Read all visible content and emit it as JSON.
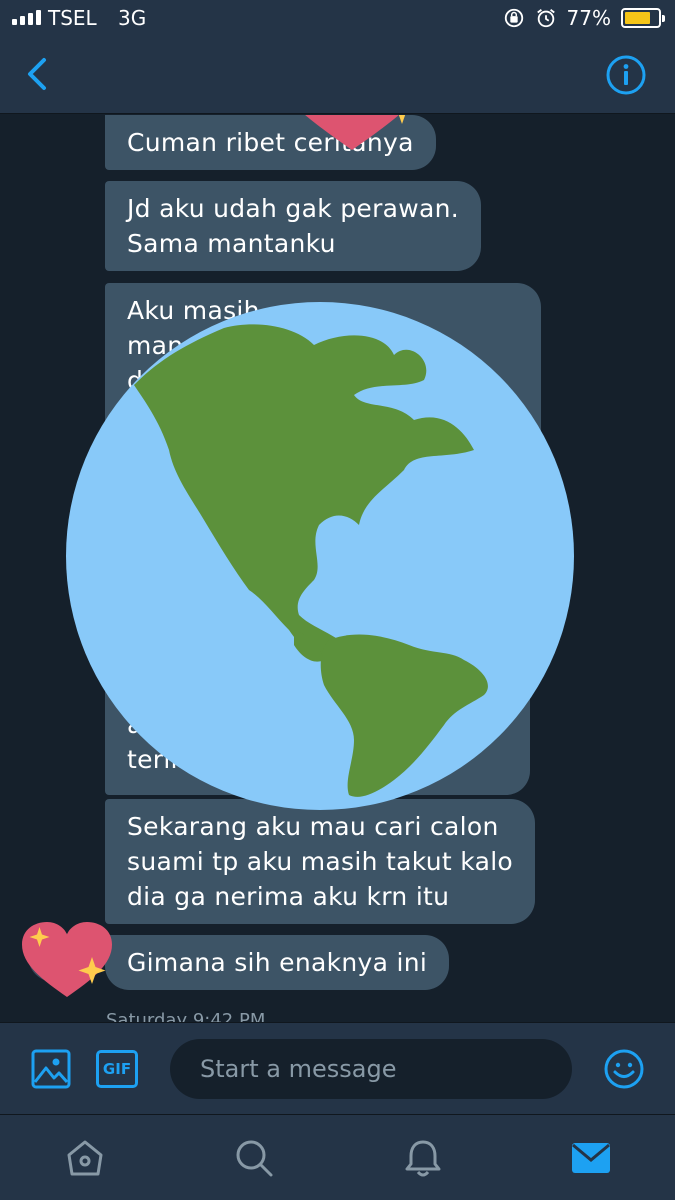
{
  "status_bar": {
    "carrier": "TSEL",
    "network": "3G",
    "battery": "77%",
    "battery_level": 0.77
  },
  "header": {
    "back_icon": "chevron-left-icon",
    "info_icon": "info-icon"
  },
  "messages": [
    {
      "text": "Cuman ribet ceritanya"
    },
    {
      "text": "Jd aku udah gak perawan.\nSama mantanku"
    },
    {
      "text": "Aku masih ... \nman ... juga\nd"
    },
    {
      "text": "a\nterim"
    },
    {
      "text": "Sekarang aku mau cari calon\nsuami tp aku masih takut kalo\ndia ga nerima aku krn itu"
    },
    {
      "text": "Gimana sih enaknya ini"
    }
  ],
  "timestamp": "Saturday 9:42 PM",
  "composer": {
    "placeholder": "Start a message",
    "gif_label": "GIF"
  },
  "tab_bar": {
    "items": [
      "home-icon",
      "search-icon",
      "notifications-icon",
      "messages-icon"
    ]
  },
  "colors": {
    "accent": "#1da1f2",
    "bubble": "#3d5466",
    "background": "#15202b",
    "header": "#243447"
  }
}
